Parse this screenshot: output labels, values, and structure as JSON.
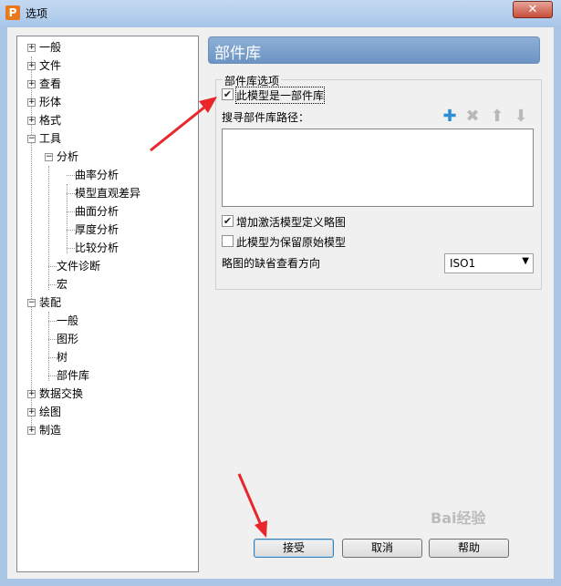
{
  "window": {
    "title": "选项",
    "app_icon": "P",
    "close_label": "✕"
  },
  "tree": {
    "items": [
      {
        "label": "一般"
      },
      {
        "label": "文件"
      },
      {
        "label": "查看"
      },
      {
        "label": "形体"
      },
      {
        "label": "格式"
      },
      {
        "label": "工具"
      },
      {
        "label": "分析"
      },
      {
        "label": "曲率分析"
      },
      {
        "label": "模型直观差异"
      },
      {
        "label": "曲面分析"
      },
      {
        "label": "厚度分析"
      },
      {
        "label": "比较分析"
      },
      {
        "label": "文件诊断"
      },
      {
        "label": "宏"
      },
      {
        "label": "装配"
      },
      {
        "label": "一般"
      },
      {
        "label": "图形"
      },
      {
        "label": "树"
      },
      {
        "label": "部件库"
      },
      {
        "label": "数据交换"
      },
      {
        "label": "绘图"
      },
      {
        "label": "制造"
      }
    ]
  },
  "panel": {
    "title": "部件库",
    "group_label": "部件库选项",
    "is_library": {
      "label": "此模型是一部件库",
      "checked": true
    },
    "search_path_label": "搜寻部件库路径：",
    "toolbar_icons": [
      "add-icon",
      "delete-icon",
      "move-up-icon",
      "move-down-icon"
    ],
    "search_paths": [],
    "add_activation_sketch": {
      "label": "增加激活模型定义略图",
      "checked": true
    },
    "keep_original": {
      "label": "此模型为保留原始模型",
      "checked": false
    },
    "sketch_direction_label": "略图的缺省查看方向",
    "sketch_direction_value": "ISO1"
  },
  "buttons": {
    "accept": "接受",
    "cancel": "取消",
    "help": "帮助"
  },
  "watermark": "Bai经验"
}
